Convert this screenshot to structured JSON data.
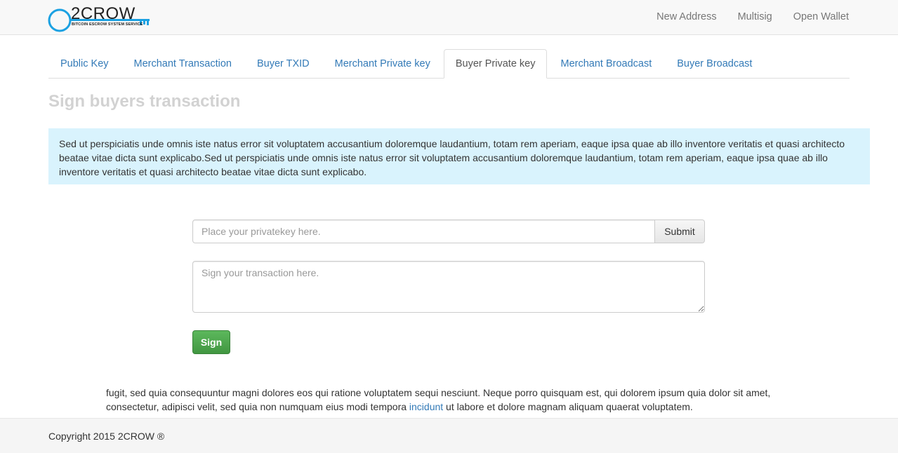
{
  "brand": {
    "name": "2CROW",
    "tagline": "BITCOIN ESCROW SYSTEM SERVICE",
    "icon": "key-logo-icon",
    "accent_color": "#1ba1e2"
  },
  "nav": {
    "items": [
      {
        "label": "New Address"
      },
      {
        "label": "Multisig"
      },
      {
        "label": "Open Wallet"
      }
    ]
  },
  "tabs": [
    {
      "label": "Public Key",
      "active": false
    },
    {
      "label": "Merchant Transaction",
      "active": false
    },
    {
      "label": "Buyer TXID",
      "active": false
    },
    {
      "label": "Merchant Private key",
      "active": false
    },
    {
      "label": "Buyer Private key",
      "active": true
    },
    {
      "label": "Merchant Broadcast",
      "active": false
    },
    {
      "label": "Buyer Broadcast",
      "active": false
    }
  ],
  "page": {
    "title": "Sign buyers transaction",
    "info_text": "Sed ut perspiciatis unde omnis iste natus error sit voluptatem accusantium doloremque laudantium, totam rem aperiam, eaque ipsa quae ab illo inventore veritatis et quasi architecto beatae vitae dicta sunt explicabo.Sed ut perspiciatis unde omnis iste natus error sit voluptatem accusantium doloremque laudantium, totam rem aperiam, eaque ipsa quae ab illo inventore veritatis et quasi architecto beatae vitae dicta sunt explicabo."
  },
  "form": {
    "privatekey_placeholder": "Place your privatekey here.",
    "privatekey_value": "",
    "submit_label": "Submit",
    "transaction_placeholder": "Sign your transaction here.",
    "transaction_value": "",
    "sign_label": "Sign",
    "sign_color": "#5cb85c"
  },
  "bottom": {
    "text_before": "fugit, sed quia consequuntur magni dolores eos qui ratione voluptatem sequi nesciunt. Neque porro quisquam est, qui dolorem ipsum quia dolor sit amet, consectetur, adipisci velit, sed quia non numquam eius modi tempora ",
    "link_text": "incidunt",
    "text_after": " ut labore et dolore magnam aliquam quaerat voluptatem."
  },
  "footer": {
    "copyright": "Copyright 2015 2CROW ®"
  }
}
